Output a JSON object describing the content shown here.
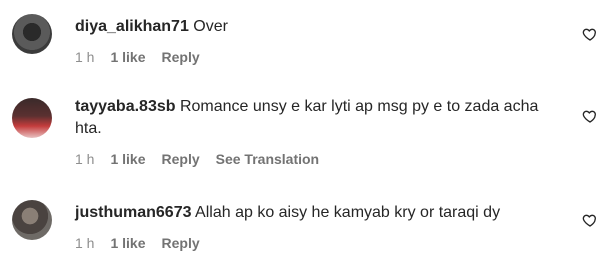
{
  "comments": [
    {
      "username": "diya_alikhan71",
      "text": "Over",
      "time": "1 h",
      "likes": "1 like",
      "reply": "Reply"
    },
    {
      "username": "tayyaba.83sb",
      "text": "Romance unsy e kar lyti ap msg py e to zada acha hta.",
      "time": "1 h",
      "likes": "1 like",
      "reply": "Reply",
      "translate": "See Translation"
    },
    {
      "username": "justhuman6673",
      "text": "Allah ap ko aisy he kamyab kry or taraqi dy",
      "time": "1 h",
      "likes": "1 like",
      "reply": "Reply"
    }
  ],
  "icons": {
    "avatar": "avatar",
    "like": "heart-icon"
  }
}
